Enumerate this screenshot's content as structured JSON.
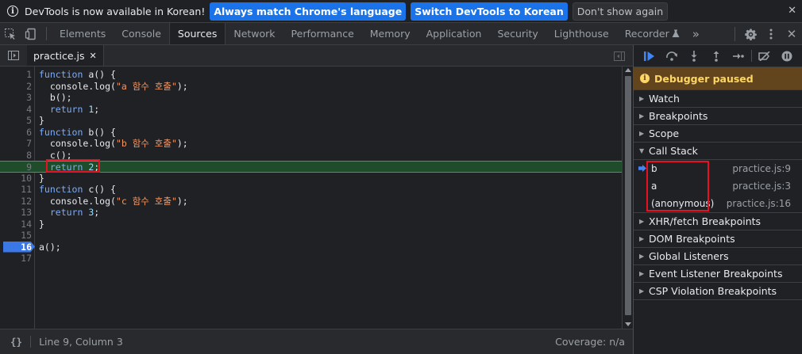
{
  "infobar": {
    "message": "DevTools is now available in Korean!",
    "match_language_label": "Always match Chrome's language",
    "switch_label": "Switch DevTools to Korean",
    "dismiss_label": "Don't show again",
    "close_glyph": "✕"
  },
  "toolbar": {
    "tabs": [
      "Elements",
      "Console",
      "Sources",
      "Network",
      "Performance",
      "Memory",
      "Application",
      "Security",
      "Lighthouse",
      "Recorder"
    ],
    "active_tab": "Sources",
    "overflow_glyph": "»",
    "recorder_icon": "flask-icon"
  },
  "editor": {
    "file_tab": "practice.js",
    "file_tab_close": "✕",
    "current_line": 9,
    "breakpoint_line": 16,
    "lines": [
      {
        "n": "1",
        "text": "function a() {"
      },
      {
        "n": "2",
        "text": "  console.log(\"a 함수 호출\");"
      },
      {
        "n": "3",
        "text": "  b();"
      },
      {
        "n": "4",
        "text": "  return 1;"
      },
      {
        "n": "5",
        "text": "}"
      },
      {
        "n": "6",
        "text": "function b() {"
      },
      {
        "n": "7",
        "text": "  console.log(\"b 함수 호출\");"
      },
      {
        "n": "8",
        "text": "  c();"
      },
      {
        "n": "9",
        "text": "  return 2;"
      },
      {
        "n": "10",
        "text": "}"
      },
      {
        "n": "11",
        "text": "function c() {"
      },
      {
        "n": "12",
        "text": "  console.log(\"c 함수 호출\");"
      },
      {
        "n": "13",
        "text": "  return 3;"
      },
      {
        "n": "14",
        "text": "}"
      },
      {
        "n": "15",
        "text": ""
      },
      {
        "n": "16",
        "text": "a();"
      },
      {
        "n": "17",
        "text": ""
      }
    ]
  },
  "status": {
    "format_glyph": "{}",
    "position": "Line 9, Column 3",
    "coverage": "Coverage: n/a"
  },
  "debugger": {
    "paused_label": "Debugger paused",
    "sections_before": [
      "Watch",
      "Breakpoints",
      "Scope"
    ],
    "call_stack_label": "Call Stack",
    "frames": [
      {
        "name": "b",
        "location": "practice.js:9",
        "current": true
      },
      {
        "name": "a",
        "location": "practice.js:3",
        "current": false
      },
      {
        "name": "(anonymous)",
        "location": "practice.js:16",
        "current": false
      }
    ],
    "sections_after": [
      "XHR/fetch Breakpoints",
      "DOM Breakpoints",
      "Global Listeners",
      "Event Listener Breakpoints",
      "CSP Violation Breakpoints"
    ]
  },
  "colors": {
    "accent_blue": "#1a73e8",
    "paused_banner": "#62441d",
    "highlight_red": "#e81123",
    "exec_line_green": "#1f4c2a"
  }
}
